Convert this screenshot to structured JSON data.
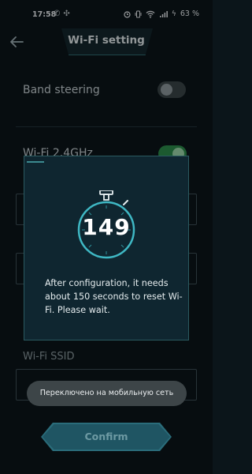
{
  "status_bar": {
    "time": "17:58",
    "battery": "63 %"
  },
  "header": {
    "title": "Wi-Fi setting"
  },
  "settings": {
    "band_steering_label": "Band steering",
    "band_steering_on": false,
    "wifi_24_label": "Wi-Fi 2.4GHz",
    "wifi_24_on": true,
    "wifi_ssid_label": "Wi-Fi SSID"
  },
  "modal": {
    "countdown": "149",
    "message": "After configuration, it needs about 150 seconds to reset Wi-Fi. Please wait."
  },
  "toast": {
    "text": "Переключено на мобильную сеть"
  },
  "footer": {
    "confirm_label": "Confirm"
  },
  "colors": {
    "accent": "#3fb8c4",
    "background": "#0b151a"
  }
}
